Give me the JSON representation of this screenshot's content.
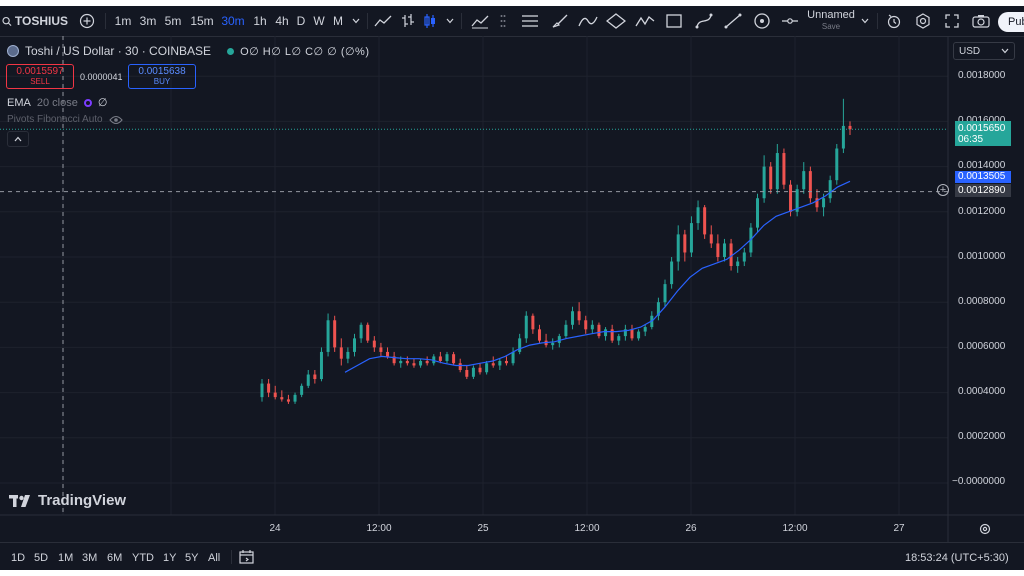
{
  "toolbar": {
    "symbol": "TOSHIUS",
    "timeframes": [
      "1m",
      "3m",
      "5m",
      "15m",
      "30m",
      "1h",
      "4h",
      "D",
      "W",
      "M"
    ],
    "active_timeframe": "30m",
    "layout_name": "Unnamed",
    "layout_status": "Save",
    "publish_label": "Pub"
  },
  "legend": {
    "title": "Toshi / US Dollar · 30 · COINBASE",
    "ohlc": "O∅ H∅ L∅ C∅ ∅ (∅%)",
    "sell_price": "0.0015597",
    "sell_label": "SELL",
    "spread": "0.0000041",
    "buy_price": "0.0015638",
    "buy_label": "BUY",
    "ema_name": "EMA",
    "ema_params": "20 close",
    "ema_value": "∅",
    "pivots": "Pivots Fibonacci Auto"
  },
  "price_scale": {
    "currency": "USD",
    "labels": [
      "0.0018000",
      "0.0016000",
      "0.0014000",
      "0.0012000",
      "0.0010000",
      "0.0008000",
      "0.0006000",
      "0.0004000",
      "0.0002000",
      "−0.0000000"
    ],
    "last_price": "0.0015650",
    "countdown": "06:35",
    "ema_tag": "0.0013505",
    "crosshair_price": "0.0012890"
  },
  "time_scale": {
    "labels": [
      "24",
      "12:00",
      "25",
      "12:00",
      "26",
      "12:00",
      "27"
    ]
  },
  "bottom_bar": {
    "ranges": [
      "1D",
      "5D",
      "1M",
      "3M",
      "6M",
      "YTD",
      "1Y",
      "5Y",
      "All"
    ],
    "clock": "18:53:24 (UTC+5:30)"
  },
  "branding": {
    "logo_text": "TradingView"
  },
  "colors": {
    "up": "#26a69a",
    "down": "#ef5350",
    "ema": "#2962ff",
    "background": "#131722",
    "accent": "#2962ff"
  },
  "chart_data": {
    "type": "candlestick",
    "symbol": "Toshi / US Dollar",
    "interval": "30",
    "exchange": "COINBASE",
    "ylim": [
      0,
      0.0019
    ],
    "y_ticks": [
      0.0018,
      0.0016,
      0.0014,
      0.0012,
      0.001,
      0.0008,
      0.0006,
      0.0004,
      0.0002,
      0
    ],
    "candles": [
      {
        "o": 0.00038,
        "h": 0.00046,
        "l": 0.00036,
        "c": 0.00044
      },
      {
        "o": 0.00044,
        "h": 0.00046,
        "l": 0.00038,
        "c": 0.0004
      },
      {
        "o": 0.0004,
        "h": 0.00043,
        "l": 0.00037,
        "c": 0.00038
      },
      {
        "o": 0.00038,
        "h": 0.00041,
        "l": 0.00036,
        "c": 0.00037
      },
      {
        "o": 0.00037,
        "h": 0.00039,
        "l": 0.00035,
        "c": 0.00036
      },
      {
        "o": 0.00036,
        "h": 0.0004,
        "l": 0.00035,
        "c": 0.00039
      },
      {
        "o": 0.00039,
        "h": 0.00044,
        "l": 0.00038,
        "c": 0.00043
      },
      {
        "o": 0.00043,
        "h": 0.0005,
        "l": 0.00042,
        "c": 0.00048
      },
      {
        "o": 0.00048,
        "h": 0.0005,
        "l": 0.00044,
        "c": 0.00046
      },
      {
        "o": 0.00046,
        "h": 0.0006,
        "l": 0.00045,
        "c": 0.00058
      },
      {
        "o": 0.00058,
        "h": 0.00075,
        "l": 0.00056,
        "c": 0.00072
      },
      {
        "o": 0.00072,
        "h": 0.00074,
        "l": 0.00058,
        "c": 0.0006
      },
      {
        "o": 0.0006,
        "h": 0.00064,
        "l": 0.00052,
        "c": 0.00055
      },
      {
        "o": 0.00055,
        "h": 0.0006,
        "l": 0.00053,
        "c": 0.00058
      },
      {
        "o": 0.00058,
        "h": 0.00066,
        "l": 0.00056,
        "c": 0.00064
      },
      {
        "o": 0.00064,
        "h": 0.00071,
        "l": 0.00062,
        "c": 0.0007
      },
      {
        "o": 0.0007,
        "h": 0.00071,
        "l": 0.00062,
        "c": 0.00063
      },
      {
        "o": 0.00063,
        "h": 0.00065,
        "l": 0.00058,
        "c": 0.0006
      },
      {
        "o": 0.0006,
        "h": 0.00062,
        "l": 0.00056,
        "c": 0.00058
      },
      {
        "o": 0.00058,
        "h": 0.0006,
        "l": 0.00055,
        "c": 0.00056
      },
      {
        "o": 0.00056,
        "h": 0.00058,
        "l": 0.00052,
        "c": 0.00053
      },
      {
        "o": 0.00053,
        "h": 0.00056,
        "l": 0.00051,
        "c": 0.00054
      },
      {
        "o": 0.00054,
        "h": 0.00056,
        "l": 0.00052,
        "c": 0.00053
      },
      {
        "o": 0.00053,
        "h": 0.00055,
        "l": 0.00051,
        "c": 0.00052
      },
      {
        "o": 0.00052,
        "h": 0.00055,
        "l": 0.00051,
        "c": 0.00054
      },
      {
        "o": 0.00054,
        "h": 0.00056,
        "l": 0.00052,
        "c": 0.00053
      },
      {
        "o": 0.00053,
        "h": 0.00057,
        "l": 0.00052,
        "c": 0.00056
      },
      {
        "o": 0.00056,
        "h": 0.00058,
        "l": 0.00053,
        "c": 0.00054
      },
      {
        "o": 0.00054,
        "h": 0.00058,
        "l": 0.00053,
        "c": 0.00057
      },
      {
        "o": 0.00057,
        "h": 0.00058,
        "l": 0.00052,
        "c": 0.00053
      },
      {
        "o": 0.00053,
        "h": 0.00055,
        "l": 0.00049,
        "c": 0.0005
      },
      {
        "o": 0.0005,
        "h": 0.00052,
        "l": 0.00046,
        "c": 0.00047
      },
      {
        "o": 0.00047,
        "h": 0.00052,
        "l": 0.00046,
        "c": 0.00051
      },
      {
        "o": 0.00051,
        "h": 0.00053,
        "l": 0.00048,
        "c": 0.00049
      },
      {
        "o": 0.00049,
        "h": 0.00054,
        "l": 0.00048,
        "c": 0.00053
      },
      {
        "o": 0.00053,
        "h": 0.00056,
        "l": 0.00051,
        "c": 0.00052
      },
      {
        "o": 0.00052,
        "h": 0.00055,
        "l": 0.0005,
        "c": 0.00054
      },
      {
        "o": 0.00054,
        "h": 0.00056,
        "l": 0.00052,
        "c": 0.00053
      },
      {
        "o": 0.00053,
        "h": 0.0006,
        "l": 0.00052,
        "c": 0.00058
      },
      {
        "o": 0.00058,
        "h": 0.00066,
        "l": 0.00057,
        "c": 0.00064
      },
      {
        "o": 0.00064,
        "h": 0.00076,
        "l": 0.00062,
        "c": 0.00074
      },
      {
        "o": 0.00074,
        "h": 0.00075,
        "l": 0.00066,
        "c": 0.00068
      },
      {
        "o": 0.00068,
        "h": 0.0007,
        "l": 0.00062,
        "c": 0.00063
      },
      {
        "o": 0.00063,
        "h": 0.00066,
        "l": 0.0006,
        "c": 0.00061
      },
      {
        "o": 0.00061,
        "h": 0.00064,
        "l": 0.00059,
        "c": 0.00062
      },
      {
        "o": 0.00062,
        "h": 0.00066,
        "l": 0.0006,
        "c": 0.00065
      },
      {
        "o": 0.00065,
        "h": 0.00072,
        "l": 0.00064,
        "c": 0.0007
      },
      {
        "o": 0.0007,
        "h": 0.00078,
        "l": 0.00068,
        "c": 0.00076
      },
      {
        "o": 0.00076,
        "h": 0.0008,
        "l": 0.0007,
        "c": 0.00072
      },
      {
        "o": 0.00072,
        "h": 0.00074,
        "l": 0.00066,
        "c": 0.00068
      },
      {
        "o": 0.00068,
        "h": 0.00072,
        "l": 0.00066,
        "c": 0.0007
      },
      {
        "o": 0.0007,
        "h": 0.00071,
        "l": 0.00064,
        "c": 0.00065
      },
      {
        "o": 0.00065,
        "h": 0.00069,
        "l": 0.00063,
        "c": 0.00068
      },
      {
        "o": 0.00068,
        "h": 0.0007,
        "l": 0.00062,
        "c": 0.00063
      },
      {
        "o": 0.00063,
        "h": 0.00066,
        "l": 0.00061,
        "c": 0.00065
      },
      {
        "o": 0.00065,
        "h": 0.0007,
        "l": 0.00063,
        "c": 0.00068
      },
      {
        "o": 0.00068,
        "h": 0.0007,
        "l": 0.00063,
        "c": 0.00064
      },
      {
        "o": 0.00064,
        "h": 0.00068,
        "l": 0.00063,
        "c": 0.00067
      },
      {
        "o": 0.00067,
        "h": 0.0007,
        "l": 0.00065,
        "c": 0.00069
      },
      {
        "o": 0.00069,
        "h": 0.00076,
        "l": 0.00068,
        "c": 0.00074
      },
      {
        "o": 0.00074,
        "h": 0.00082,
        "l": 0.00072,
        "c": 0.0008
      },
      {
        "o": 0.0008,
        "h": 0.0009,
        "l": 0.00078,
        "c": 0.00088
      },
      {
        "o": 0.00088,
        "h": 0.001,
        "l": 0.00086,
        "c": 0.00098
      },
      {
        "o": 0.00098,
        "h": 0.00114,
        "l": 0.00094,
        "c": 0.0011
      },
      {
        "o": 0.0011,
        "h": 0.00112,
        "l": 0.00098,
        "c": 0.00102
      },
      {
        "o": 0.00102,
        "h": 0.00118,
        "l": 0.001,
        "c": 0.00115
      },
      {
        "o": 0.00115,
        "h": 0.00125,
        "l": 0.00112,
        "c": 0.00122
      },
      {
        "o": 0.00122,
        "h": 0.00123,
        "l": 0.00108,
        "c": 0.0011
      },
      {
        "o": 0.0011,
        "h": 0.00114,
        "l": 0.00104,
        "c": 0.00106
      },
      {
        "o": 0.00106,
        "h": 0.0011,
        "l": 0.00098,
        "c": 0.001
      },
      {
        "o": 0.001,
        "h": 0.00108,
        "l": 0.00098,
        "c": 0.00106
      },
      {
        "o": 0.00106,
        "h": 0.00108,
        "l": 0.00094,
        "c": 0.00096
      },
      {
        "o": 0.00096,
        "h": 0.001,
        "l": 0.00093,
        "c": 0.00098
      },
      {
        "o": 0.00098,
        "h": 0.00104,
        "l": 0.00096,
        "c": 0.00102
      },
      {
        "o": 0.00102,
        "h": 0.00115,
        "l": 0.001,
        "c": 0.00113
      },
      {
        "o": 0.00113,
        "h": 0.00128,
        "l": 0.00111,
        "c": 0.00126
      },
      {
        "o": 0.00126,
        "h": 0.00145,
        "l": 0.00124,
        "c": 0.0014
      },
      {
        "o": 0.0014,
        "h": 0.00142,
        "l": 0.00128,
        "c": 0.0013
      },
      {
        "o": 0.0013,
        "h": 0.0015,
        "l": 0.00128,
        "c": 0.00146
      },
      {
        "o": 0.00146,
        "h": 0.00148,
        "l": 0.0013,
        "c": 0.00132
      },
      {
        "o": 0.00132,
        "h": 0.00134,
        "l": 0.00118,
        "c": 0.0012
      },
      {
        "o": 0.0012,
        "h": 0.00132,
        "l": 0.00118,
        "c": 0.0013
      },
      {
        "o": 0.0013,
        "h": 0.00142,
        "l": 0.00128,
        "c": 0.00138
      },
      {
        "o": 0.00138,
        "h": 0.0014,
        "l": 0.00124,
        "c": 0.00126
      },
      {
        "o": 0.00126,
        "h": 0.0013,
        "l": 0.0012,
        "c": 0.00122
      },
      {
        "o": 0.00122,
        "h": 0.00128,
        "l": 0.00118,
        "c": 0.00126
      },
      {
        "o": 0.00126,
        "h": 0.00136,
        "l": 0.00124,
        "c": 0.00134
      },
      {
        "o": 0.00134,
        "h": 0.0015,
        "l": 0.00132,
        "c": 0.00148
      },
      {
        "o": 0.00148,
        "h": 0.0017,
        "l": 0.00146,
        "c": 0.00158
      },
      {
        "o": 0.00158,
        "h": 0.0016,
        "l": 0.00154,
        "c": 0.001565
      }
    ],
    "ema": [
      0.00049,
      0.00052,
      0.00055,
      0.00056,
      0.000555,
      0.00055,
      0.00055,
      0.000545,
      0.00053,
      0.00052,
      0.00052,
      0.00053,
      0.00054,
      0.00056,
      0.00059,
      0.00061,
      0.00062,
      0.000625,
      0.00064,
      0.00065,
      0.00066,
      0.00067,
      0.00067,
      0.000675,
      0.00069,
      0.00072,
      0.00078,
      0.00085,
      0.00091,
      0.00095,
      0.00097,
      0.00099,
      0.00103,
      0.00108,
      0.00114,
      0.00118,
      0.0012,
      0.00122,
      0.00124,
      0.00127,
      0.00131,
      0.001335
    ],
    "crosshair_price": 0.001289
  }
}
